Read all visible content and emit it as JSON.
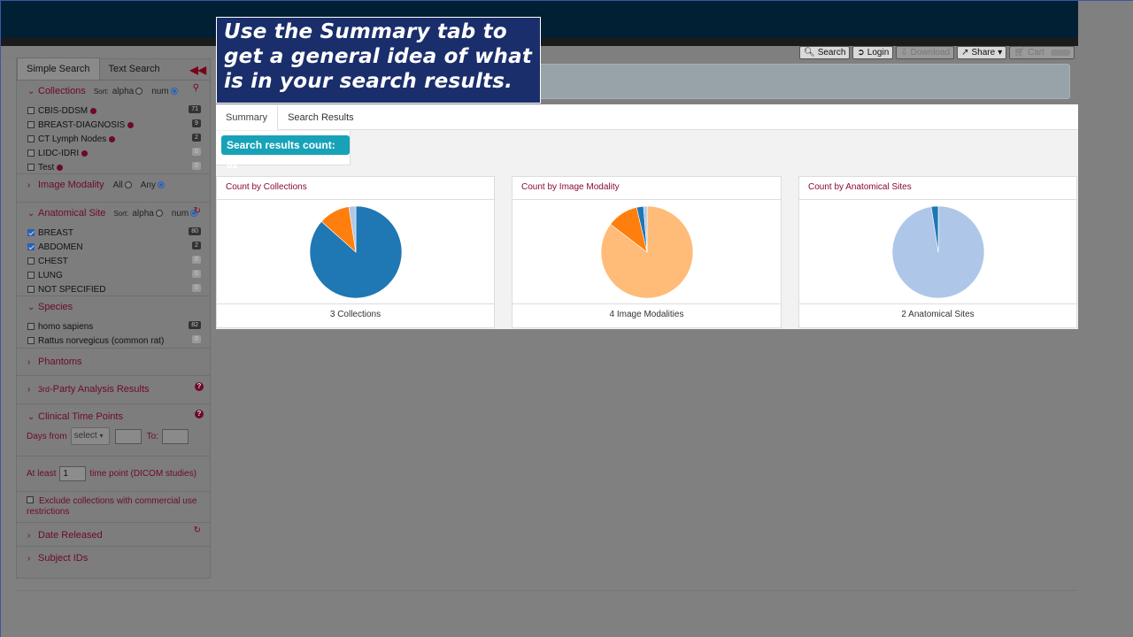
{
  "nav": {
    "search": "Search",
    "login": "Login",
    "download": "Download",
    "share": "Share",
    "cart": "Cart"
  },
  "callout": {
    "text": "Use the Summary tab to get a general idea of what is in your search results."
  },
  "sidebar": {
    "tabs": [
      "Simple Search",
      "Text Search"
    ],
    "collections": {
      "title": "Collections",
      "sort_label": "Sort:",
      "sort_alpha": "alpha",
      "sort_num": "num",
      "items": [
        {
          "label": "CBIS-DDSM",
          "count": "71",
          "checked": false
        },
        {
          "label": "BREAST-DIAGNOSIS",
          "count": "9",
          "checked": false
        },
        {
          "label": "CT Lymph Nodes",
          "count": "2",
          "checked": false
        },
        {
          "label": "LIDC-IDRI",
          "count": "0",
          "checked": false
        },
        {
          "label": "Test",
          "count": "0",
          "checked": false
        }
      ]
    },
    "modality": {
      "title": "Image Modality",
      "all": "All",
      "any": "Any"
    },
    "anatomical": {
      "title": "Anatomical Site",
      "sort_label": "Sort:",
      "sort_alpha": "alpha",
      "sort_num": "num",
      "items": [
        {
          "label": "BREAST",
          "count": "80",
          "checked": true
        },
        {
          "label": "ABDOMEN",
          "count": "2",
          "checked": true
        },
        {
          "label": "CHEST",
          "count": "0",
          "checked": false
        },
        {
          "label": "LUNG",
          "count": "0",
          "checked": false
        },
        {
          "label": "NOT SPECIFIED",
          "count": "0",
          "checked": false
        }
      ]
    },
    "species": {
      "title": "Species",
      "items": [
        {
          "label": "homo sapiens",
          "count": "82"
        },
        {
          "label": "Rattus norvegicus (common rat)",
          "count": "0"
        }
      ]
    },
    "phantoms": "Phantoms",
    "third_party": "3rd-Party Analysis Results",
    "third_party_small": "3rd",
    "third_party_rest": "-Party Analysis Results",
    "clinical": {
      "title": "Clinical Time Points",
      "days_from": "Days from",
      "select": "select",
      "to": "To:",
      "at_least": "At least",
      "at_least_value": "1",
      "time_point": "time point (DICOM studies)"
    },
    "exclude": "Exclude collections with commercial use restrictions",
    "date_released": "Date Released",
    "subject_ids": "Subject IDs"
  },
  "results": {
    "tabs": [
      "Summary",
      "Search Results"
    ],
    "count_badge": "Search results count: 82",
    "cards": [
      {
        "title": "Count by Collections",
        "footer": "3 Collections"
      },
      {
        "title": "Count by Image Modality",
        "footer": "4 Image Modalities"
      },
      {
        "title": "Count by Anatomical Sites",
        "footer": "2 Anatomical Sites"
      }
    ]
  },
  "chart_data": [
    {
      "type": "pie",
      "title": "Count by Collections",
      "values": [
        71,
        9,
        2
      ],
      "colors": [
        "#1f77b4",
        "#ff7f0e",
        "#aec7e8"
      ]
    },
    {
      "type": "pie",
      "title": "Count by Image Modality",
      "values": [
        70,
        9,
        2,
        1
      ],
      "colors": [
        "#ffbb78",
        "#ff7f0e",
        "#1f77b4",
        "#aec7e8"
      ]
    },
    {
      "type": "pie",
      "title": "Count by Anatomical Sites",
      "values": [
        80,
        2
      ],
      "colors": [
        "#aec7e8",
        "#1f77b4"
      ]
    }
  ]
}
